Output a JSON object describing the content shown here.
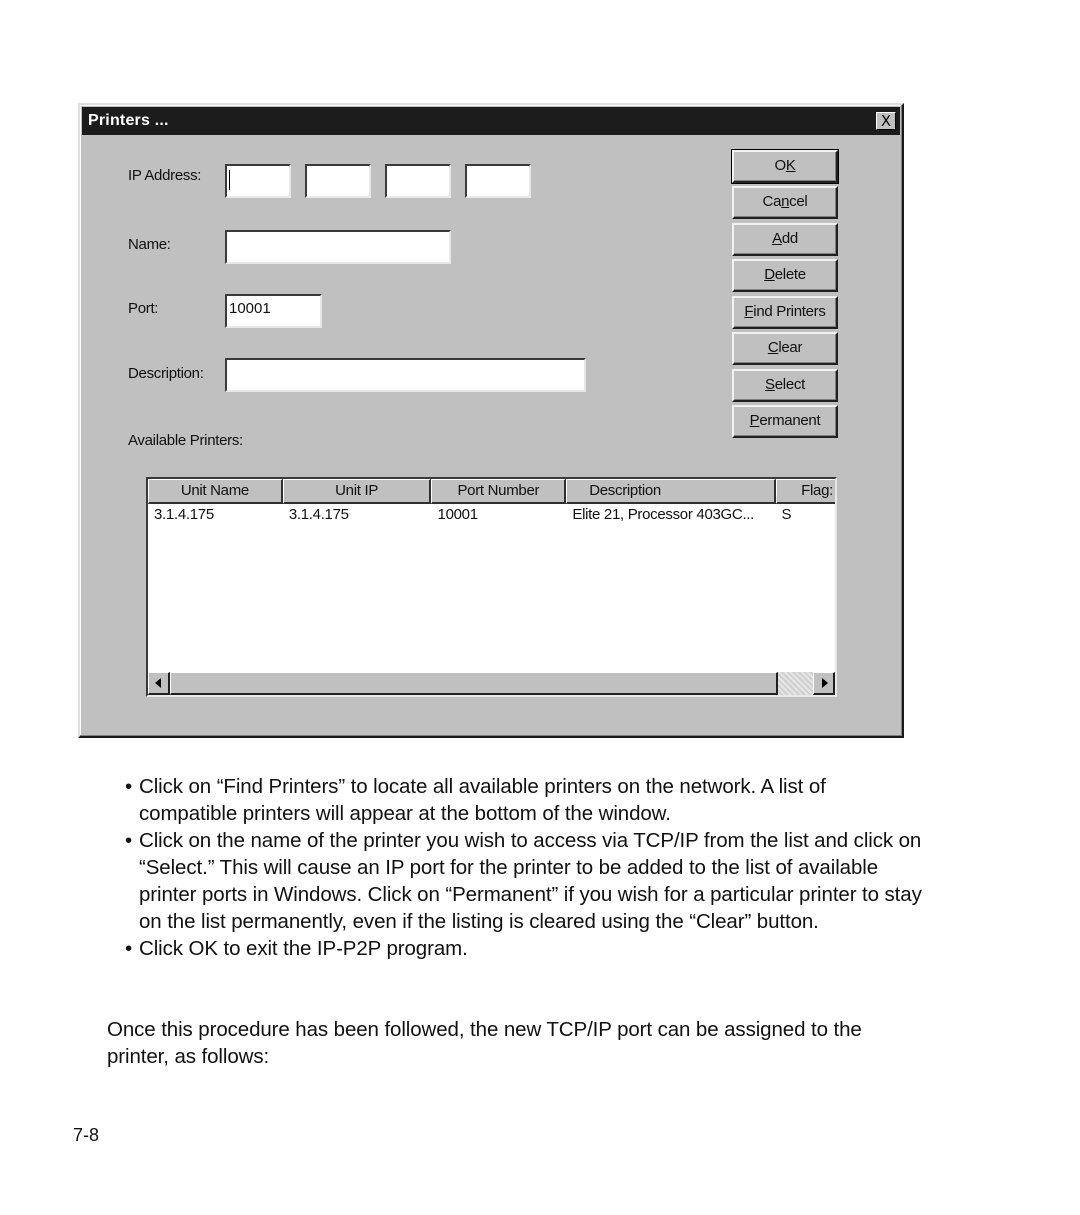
{
  "dialog": {
    "title": "Printers ...",
    "close_icon": "close-x-icon",
    "close_glyph": "X",
    "labels": {
      "ip_address": "IP Address:",
      "name": "Name:",
      "port": "Port:",
      "description": "Description:",
      "available_printers": "Available Printers:"
    },
    "fields": {
      "ip_octet_1": "",
      "ip_octet_2": "",
      "ip_octet_3": "",
      "ip_octet_4": "",
      "name": "",
      "port": "10001",
      "description": ""
    },
    "buttons": [
      {
        "label": "OK",
        "pre": "O",
        "accel": "K",
        "post": ""
      },
      {
        "label": "Cancel",
        "pre": "Ca",
        "accel": "n",
        "post": "cel"
      },
      {
        "label": "Add",
        "pre": "",
        "accel": "A",
        "post": "dd"
      },
      {
        "label": "Delete",
        "pre": "",
        "accel": "D",
        "post": "elete"
      },
      {
        "label": "Find Printers",
        "pre": "",
        "accel": "F",
        "post": "ind Printers"
      },
      {
        "label": "Clear",
        "pre": "",
        "accel": "C",
        "post": "lear"
      },
      {
        "label": "Select",
        "pre": "",
        "accel": "S",
        "post": "elect"
      },
      {
        "label": "Permanent",
        "pre": "",
        "accel": "P",
        "post": "ermanent"
      }
    ],
    "printer_list": {
      "columns": [
        "Unit Name",
        "Unit IP",
        "Port Number",
        "Description",
        "Flag:"
      ],
      "rows": [
        [
          "3.1.4.175",
          "3.1.4.175",
          "10001",
          "Elite 21, Processor 403GC...",
          "S"
        ]
      ]
    }
  },
  "document": {
    "bullets": [
      "Click on “Find Printers” to locate all available printers on the network. A list of compatible printers will appear at the bottom of the window.",
      "Click on the name of the printer you wish to access via TCP/IP from the list and click on “Select.” This will cause an IP port for the printer to be added to the list of available printer ports in Windows. Click on “Permanent” if you wish for a particular printer to stay on the list permanently, even if the listing is cleared using the “Clear” button.",
      "Click OK to exit the IP-P2P program."
    ],
    "bullet_glyph": "•",
    "paragraph": "Once this procedure has been followed, the new TCP/IP port can be assigned to the printer, as follows:",
    "page_number": "7-8"
  }
}
